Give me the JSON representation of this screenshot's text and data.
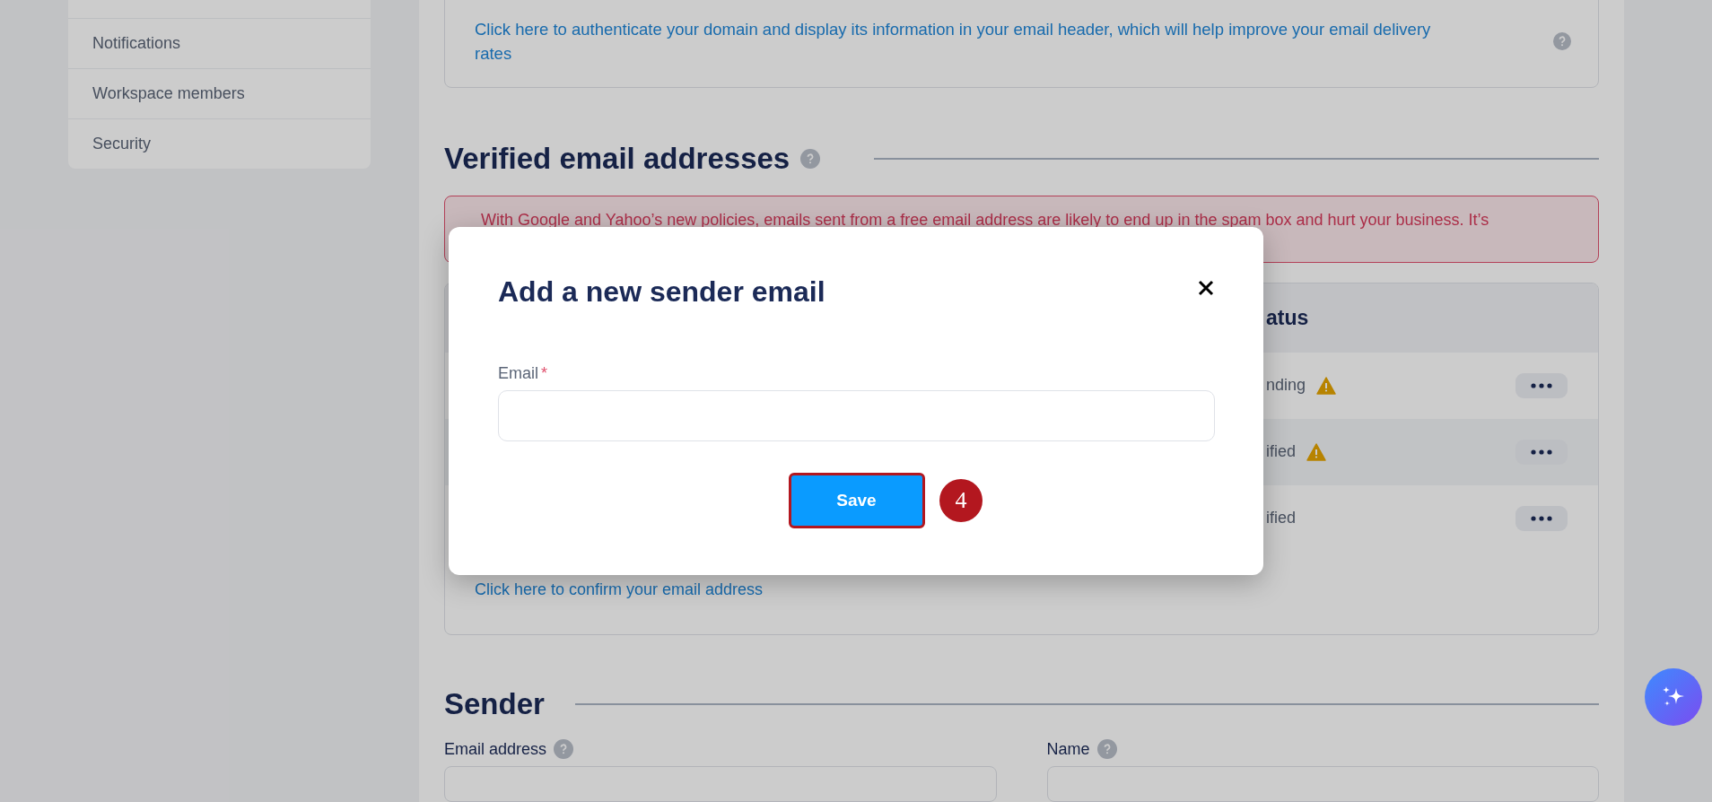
{
  "sidebar": {
    "items": [
      {
        "label": "Notifications"
      },
      {
        "label": "Workspace members"
      },
      {
        "label": "Security"
      }
    ]
  },
  "domain_card": {
    "link": "Click here to authenticate your domain and display its information in your email header, which will help improve your email delivery rates"
  },
  "verified_section": {
    "title": "Verified email addresses",
    "alert": "With Google and Yahoo’s new policies, emails sent from a free email address are likely to end up in the spam box and hurt your business. It’s",
    "table": {
      "columns": [
        {
          "label": "atus"
        }
      ],
      "rows": [
        {
          "status": "nding",
          "warning": true,
          "hovered": false
        },
        {
          "status": "ified",
          "warning": true,
          "hovered": true
        },
        {
          "status": "ified",
          "warning": false,
          "hovered": false
        }
      ]
    },
    "confirm_link": "Click here to confirm your email address"
  },
  "sender_section": {
    "title": "Sender",
    "fields": [
      {
        "label": "Email address"
      },
      {
        "label": "Name"
      }
    ]
  },
  "modal": {
    "title": "Add a new sender email",
    "field": {
      "label": "Email",
      "required_mark": "*"
    },
    "save_button": "Save",
    "step_badge": "4"
  }
}
